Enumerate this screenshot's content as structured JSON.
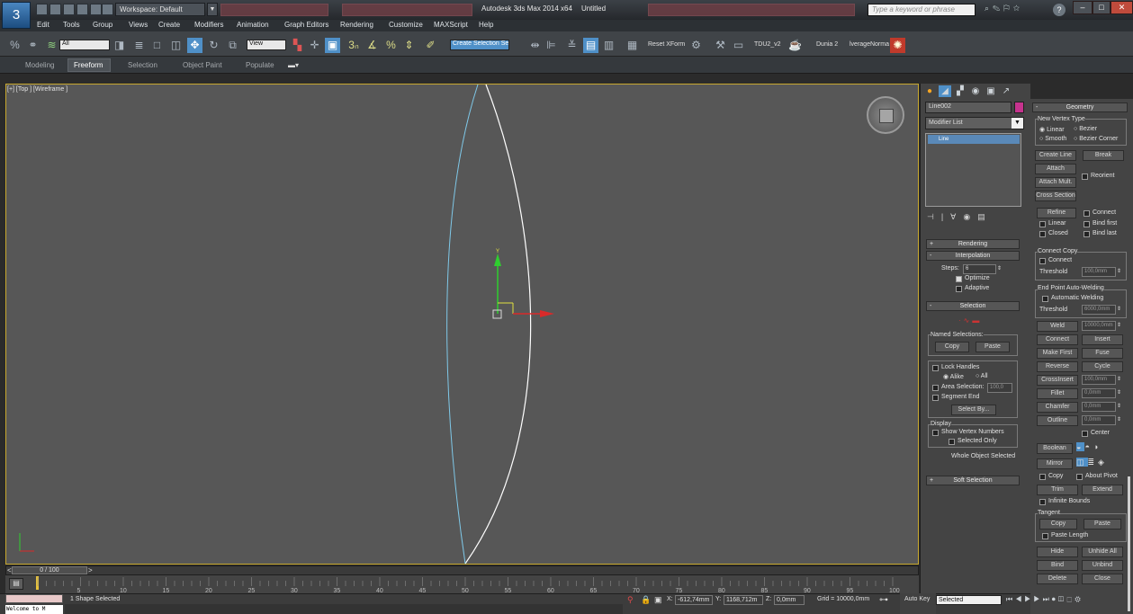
{
  "title_bar": {
    "app_title": "Autodesk 3ds Max 2014 x64",
    "doc_title": "Untitled",
    "workspace_label": "Workspace: Default",
    "search_placeholder": "Type a keyword or phrase",
    "app_button_label": "3"
  },
  "menu": [
    "Edit",
    "Tools",
    "Group",
    "Views",
    "Create",
    "Modifiers",
    "Animation",
    "Graph Editors",
    "Rendering",
    "Customize",
    "MAXScript",
    "Help"
  ],
  "main_toolbar": {
    "filter_value": "All",
    "ref_coord_value": "View",
    "named_selection_value": "Create Selection Se",
    "snap_label": "3",
    "reset_xform_label": "Reset XForm",
    "tdu_label": "TDU2_v2",
    "dunia_label": "Dunia 2",
    "normal_label": "lverageNorma"
  },
  "ribbon_tabs": [
    "Modeling",
    "Freeform",
    "Selection",
    "Object Paint",
    "Populate"
  ],
  "ribbon_active": "Freeform",
  "viewport": {
    "label": "[+] [Top ] [Wireframe ]",
    "active_border_color": "#c7a82e",
    "shape_color": "#ffffff",
    "shape_alt_color": "#7fc8e8"
  },
  "command_panel": {
    "object_name": "Line002",
    "object_color": "#c6338e",
    "modifier_list_label": "Modifier List",
    "stack_item": "Line",
    "rendering_rollout": "Rendering",
    "interpolation_rollout": "Interpolation",
    "steps_label": "Steps:",
    "steps_value": "6",
    "optimize_label": "Optimize",
    "adaptive_label": "Adaptive",
    "selection_rollout": "Selection",
    "named_selections_label": "Named Selections:",
    "copy_label": "Copy",
    "paste_label": "Paste",
    "lock_handles_label": "Lock Handles",
    "alike_label": "Alike",
    "all_label": "All",
    "area_selection_label": "Area Selection:",
    "area_selection_value": "100,0",
    "segment_end_label": "Segment End",
    "select_by_label": "Select By...",
    "display_label": "Display",
    "show_vertex_numbers_label": "Show Vertex Numbers",
    "selected_only_label": "Selected Only",
    "whole_object_selected": "Whole Object Selected",
    "soft_selection_rollout": "Soft Selection"
  },
  "geometry_panel": {
    "rollout_title": "Geometry",
    "new_vertex_type_label": "New Vertex Type",
    "linear_label": "Linear",
    "bezier_label": "Bezier",
    "smooth_label": "Smooth",
    "bezier_corner_label": "Bezier Corner",
    "create_line_label": "Create Line",
    "break_label": "Break",
    "attach_label": "Attach",
    "reorient_label": "Reorient",
    "attach_mult_label": "Attach Mult.",
    "cross_section_label": "Cross Section",
    "refine_label": "Refine",
    "connect_label": "Connect",
    "refine_linear_label": "Linear",
    "bind_first_label": "Bind first",
    "closed_label": "Closed",
    "bind_last_label": "Bind last",
    "connect_copy_label": "Connect Copy",
    "connect_copy_check_label": "Connect",
    "threshold_label": "Threshold",
    "threshold_value": "100,0mm",
    "end_point_welding_label": "End Point Auto-Welding",
    "automatic_welding_label": "Automatic Welding",
    "threshold2_label": "Threshold",
    "threshold2_value": "6000,0mm",
    "weld_label": "Weld",
    "weld_value": "10000,0mm",
    "connect_btn_label": "Connect",
    "insert_label": "Insert",
    "make_first_label": "Make First",
    "fuse_label": "Fuse",
    "reverse_label": "Reverse",
    "cycle_label": "Cycle",
    "crossinsert_label": "CrossInsert",
    "crossinsert_value": "100,0mm",
    "fillet_label": "Fillet",
    "fillet_value": "0,0mm",
    "chamfer_label": "Chamfer",
    "chamfer_value": "0,0mm",
    "outline_label": "Outline",
    "outline_value": "0,0mm",
    "center_label": "Center",
    "boolean_label": "Boolean",
    "mirror_label": "Mirror",
    "copy_label": "Copy",
    "about_pivot_label": "About Pivot",
    "trim_label": "Trim",
    "extend_label": "Extend",
    "infinite_bounds_label": "Infinite Bounds",
    "tangent_label": "Tangent",
    "tangent_copy_label": "Copy",
    "tangent_paste_label": "Paste",
    "paste_length_label": "Paste Length",
    "hide_label": "Hide",
    "unhide_all_label": "Unhide All",
    "bind_label": "Bind",
    "unbind_label": "Unbind",
    "delete_label": "Delete",
    "close_label": "Close"
  },
  "time_slider": {
    "value": "0 / 100"
  },
  "trackbar_ticks": [
    "5",
    "10",
    "15",
    "20",
    "25",
    "30",
    "35",
    "40",
    "45",
    "50",
    "55",
    "60",
    "65",
    "70",
    "75",
    "80",
    "85",
    "90",
    "95",
    "100"
  ],
  "status": {
    "maxscript_listener": "Welcome to M",
    "selection_status": "1 Shape Selected",
    "x_label": "X:",
    "x_value": "-612,74mm",
    "y_label": "Y:",
    "y_value": "1168,712m",
    "z_label": "Z:",
    "z_value": "0,0mm",
    "grid_label": "Grid = 10000,0mm",
    "auto_key_label": "Auto Key",
    "set_key_value": "Selected"
  }
}
